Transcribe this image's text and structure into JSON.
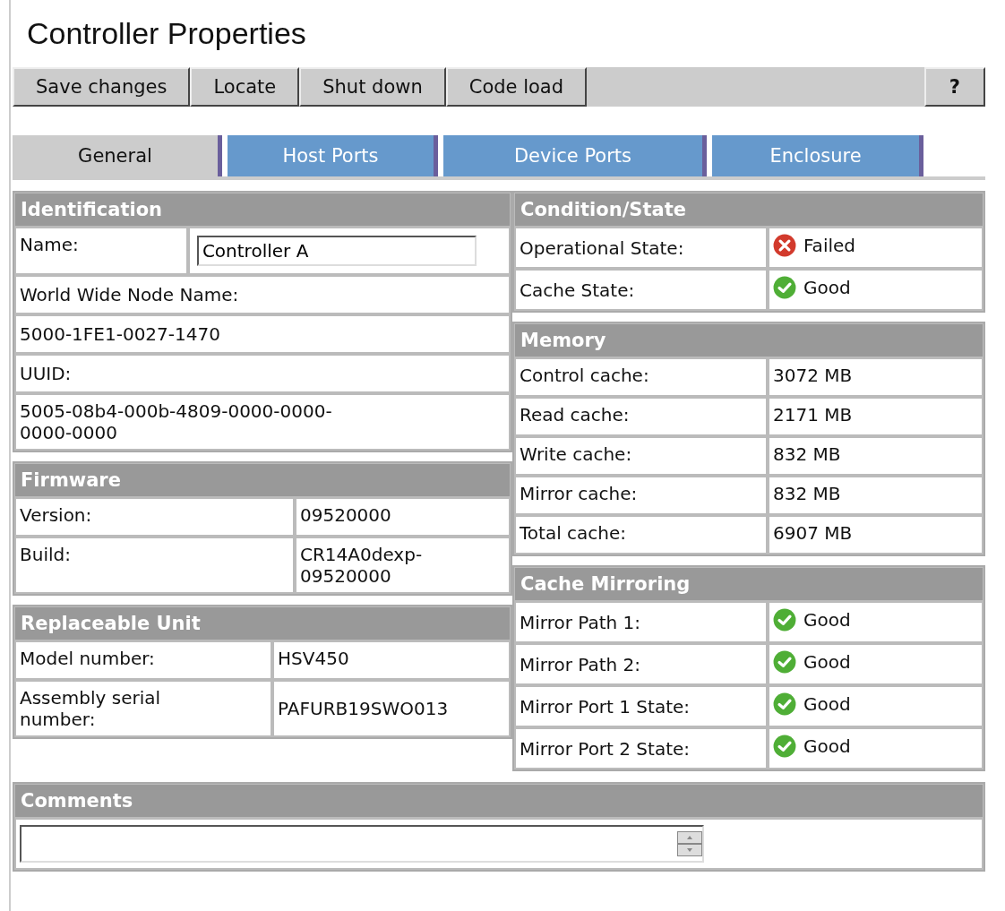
{
  "title": "Controller Properties",
  "toolbar": {
    "buttons": [
      "Save changes",
      "Locate",
      "Shut down",
      "Code load"
    ],
    "help": "?"
  },
  "tabs": [
    {
      "label": "General",
      "selected": true
    },
    {
      "label": "Host Ports",
      "selected": false
    },
    {
      "label": "Device Ports",
      "selected": false
    },
    {
      "label": "Enclosure",
      "selected": false
    }
  ],
  "left_sections": [
    {
      "title": "Identification",
      "rows": [
        {
          "kind": "input",
          "label": "Name:",
          "value": "Controller A"
        },
        {
          "kind": "full",
          "text": "World Wide Node Name:"
        },
        {
          "kind": "full",
          "text": "5000-1FE1-0027-1470"
        },
        {
          "kind": "full",
          "text": "UUID:"
        },
        {
          "kind": "full",
          "text": "5005-08b4-000b-4809-0000-0000-\n0000-0000"
        }
      ]
    },
    {
      "title": "Firmware",
      "rows": [
        {
          "kind": "pair",
          "label": "Version:",
          "value": "09520000"
        },
        {
          "kind": "pair",
          "label": "Build:",
          "value": "CR14A0dexp-\n09520000"
        }
      ]
    },
    {
      "title": "Replaceable Unit",
      "rows": [
        {
          "kind": "pair",
          "label": "Model number:",
          "value": "HSV450"
        },
        {
          "kind": "pair",
          "label": "Assembly serial\nnumber:",
          "value": "PAFURB19SWO013"
        }
      ]
    }
  ],
  "right_sections": [
    {
      "title": "Condition/State",
      "rows": [
        {
          "kind": "status",
          "label": "Operational State:",
          "failed": true,
          "value": "Failed"
        },
        {
          "kind": "status",
          "label": "Cache State:",
          "failed": false,
          "value": "Good"
        }
      ]
    },
    {
      "title": "Memory",
      "rows": [
        {
          "kind": "pair",
          "label": "Control cache:",
          "value": "3072 MB"
        },
        {
          "kind": "pair",
          "label": "Read cache:",
          "value": "2171 MB"
        },
        {
          "kind": "pair",
          "label": "Write cache:",
          "value": "832 MB"
        },
        {
          "kind": "pair",
          "label": "Mirror cache:",
          "value": "832 MB"
        },
        {
          "kind": "pair",
          "label": "Total cache:",
          "value": "6907 MB"
        }
      ]
    },
    {
      "title": "Cache Mirroring",
      "rows": [
        {
          "kind": "status",
          "label": "Mirror Path 1:",
          "failed": false,
          "value": "Good"
        },
        {
          "kind": "status",
          "label": "Mirror Path 2:",
          "failed": false,
          "value": "Good"
        },
        {
          "kind": "status",
          "label": "Mirror Port 1 State:",
          "failed": false,
          "value": "Good"
        },
        {
          "kind": "status",
          "label": "Mirror Port 2 State:",
          "failed": false,
          "value": "Good"
        }
      ]
    }
  ],
  "comments": {
    "title": "Comments"
  }
}
